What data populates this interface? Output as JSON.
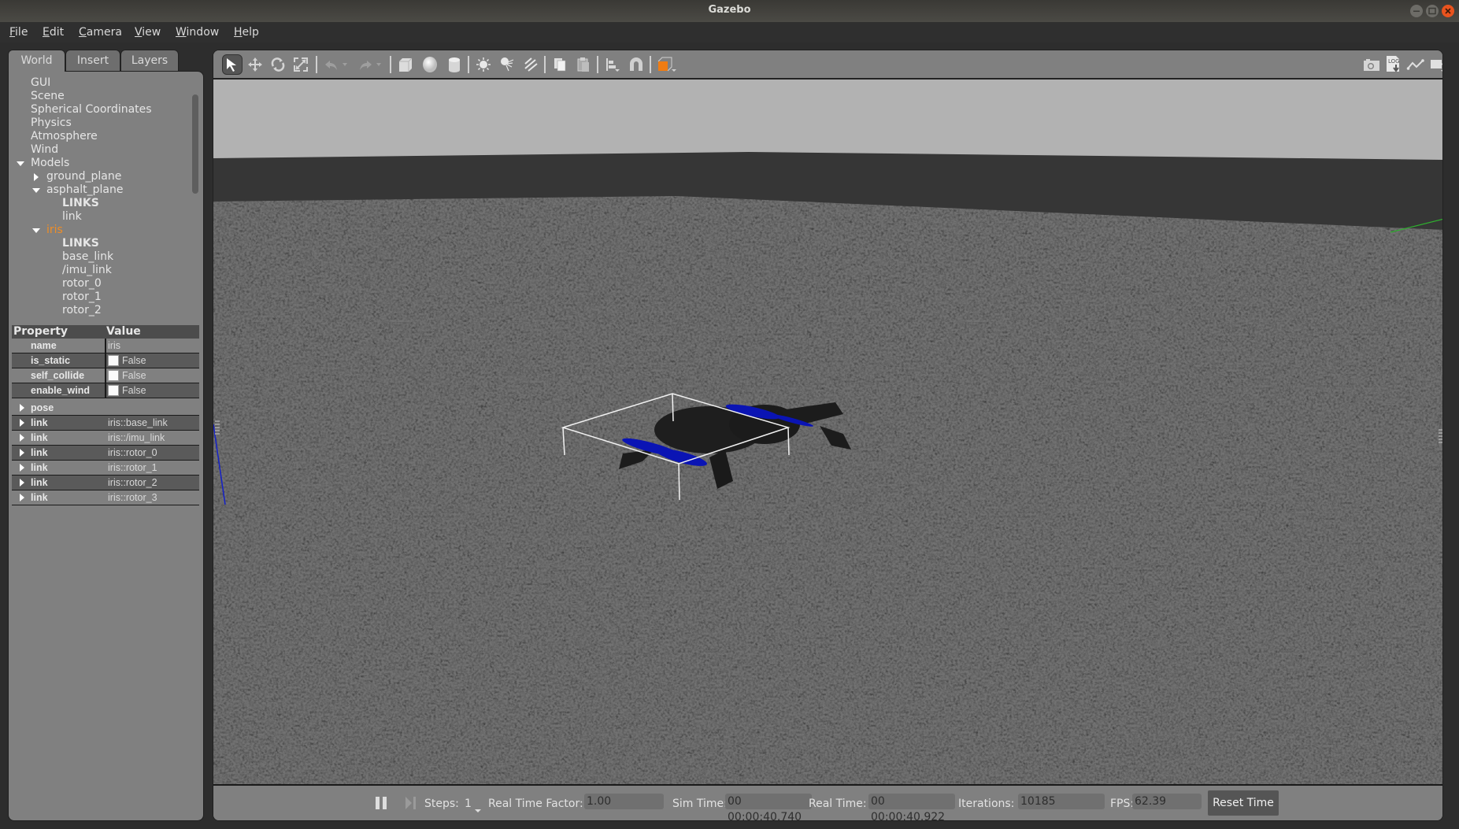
{
  "window": {
    "title": "Gazebo"
  },
  "menu": [
    "File",
    "Edit",
    "Camera",
    "View",
    "Window",
    "Help"
  ],
  "menu_mnemonic_first_letter": true,
  "left_tabs": [
    {
      "label": "World",
      "active": true
    },
    {
      "label": "Insert",
      "active": false
    },
    {
      "label": "Layers",
      "active": false
    }
  ],
  "world_tree": [
    {
      "label": "GUI",
      "level": 0,
      "expander": "none"
    },
    {
      "label": "Scene",
      "level": 0,
      "expander": "none"
    },
    {
      "label": "Spherical Coordinates",
      "level": 0,
      "expander": "none"
    },
    {
      "label": "Physics",
      "level": 0,
      "expander": "none"
    },
    {
      "label": "Atmosphere",
      "level": 0,
      "expander": "none"
    },
    {
      "label": "Wind",
      "level": 0,
      "expander": "none"
    },
    {
      "label": "Models",
      "level": 0,
      "expander": "expanded"
    },
    {
      "label": "ground_plane",
      "level": 1,
      "expander": "collapsed"
    },
    {
      "label": "asphalt_plane",
      "level": 1,
      "expander": "expanded"
    },
    {
      "label": "LINKS",
      "level": 2,
      "expander": "none",
      "bold": true
    },
    {
      "label": "link",
      "level": 2,
      "expander": "none"
    },
    {
      "label": "iris",
      "level": 1,
      "expander": "expanded",
      "selected": true
    },
    {
      "label": "LINKS",
      "level": 2,
      "expander": "none",
      "bold": true
    },
    {
      "label": "base_link",
      "level": 2,
      "expander": "none"
    },
    {
      "label": "/imu_link",
      "level": 2,
      "expander": "none"
    },
    {
      "label": "rotor_0",
      "level": 2,
      "expander": "none"
    },
    {
      "label": "rotor_1",
      "level": 2,
      "expander": "none"
    },
    {
      "label": "rotor_2",
      "level": 2,
      "expander": "none"
    }
  ],
  "properties": {
    "header": {
      "property": "Property",
      "value": "Value"
    },
    "rows": [
      {
        "key": "name",
        "value": "iris",
        "type": "text"
      },
      {
        "key": "is_static",
        "value": "False",
        "type": "checkbox"
      },
      {
        "key": "self_collide",
        "value": "False",
        "type": "checkbox"
      },
      {
        "key": "enable_wind",
        "value": "False",
        "type": "checkbox"
      },
      {
        "key": "pose",
        "value": "",
        "type": "group"
      },
      {
        "key": "link",
        "value": "iris::base_link",
        "type": "group"
      },
      {
        "key": "link",
        "value": "iris::/imu_link",
        "type": "group"
      },
      {
        "key": "link",
        "value": "iris::rotor_0",
        "type": "group"
      },
      {
        "key": "link",
        "value": "iris::rotor_1",
        "type": "group"
      },
      {
        "key": "link",
        "value": "iris::rotor_2",
        "type": "group"
      },
      {
        "key": "link",
        "value": "iris::rotor_3",
        "type": "group"
      }
    ]
  },
  "toolbar": {
    "left": [
      "select-arrow",
      "translate",
      "rotate",
      "scale",
      "undo",
      "undo-dropdown",
      "redo",
      "redo-dropdown",
      "box",
      "sphere",
      "cylinder",
      "point-light",
      "spot-light",
      "directional-light",
      "copy",
      "paste",
      "align",
      "snap",
      "view-angle"
    ],
    "right": [
      "screenshot",
      "log",
      "plot",
      "record-video"
    ],
    "active_tool": "select-arrow",
    "log_label": "LOG"
  },
  "bottom_bar": {
    "steps_label": "Steps:",
    "steps_value": "1",
    "rtf_label": "Real Time Factor:",
    "rtf_value": "1.00",
    "sim_time_label": "Sim Time:",
    "sim_time_value": "00 00:00:40.740",
    "real_time_label": "Real Time:",
    "real_time_value": "00 00:00:40.922",
    "iterations_label": "Iterations:",
    "iterations_value": "10185",
    "fps_label": "FPS:",
    "fps_value": "62.39",
    "reset_label": "Reset Time",
    "paused": false
  },
  "colors": {
    "selected_model": "#ef8d26",
    "propeller": "#0a14b4",
    "close_button": "#e9531e",
    "view_angle_accent": "#f07c12"
  }
}
